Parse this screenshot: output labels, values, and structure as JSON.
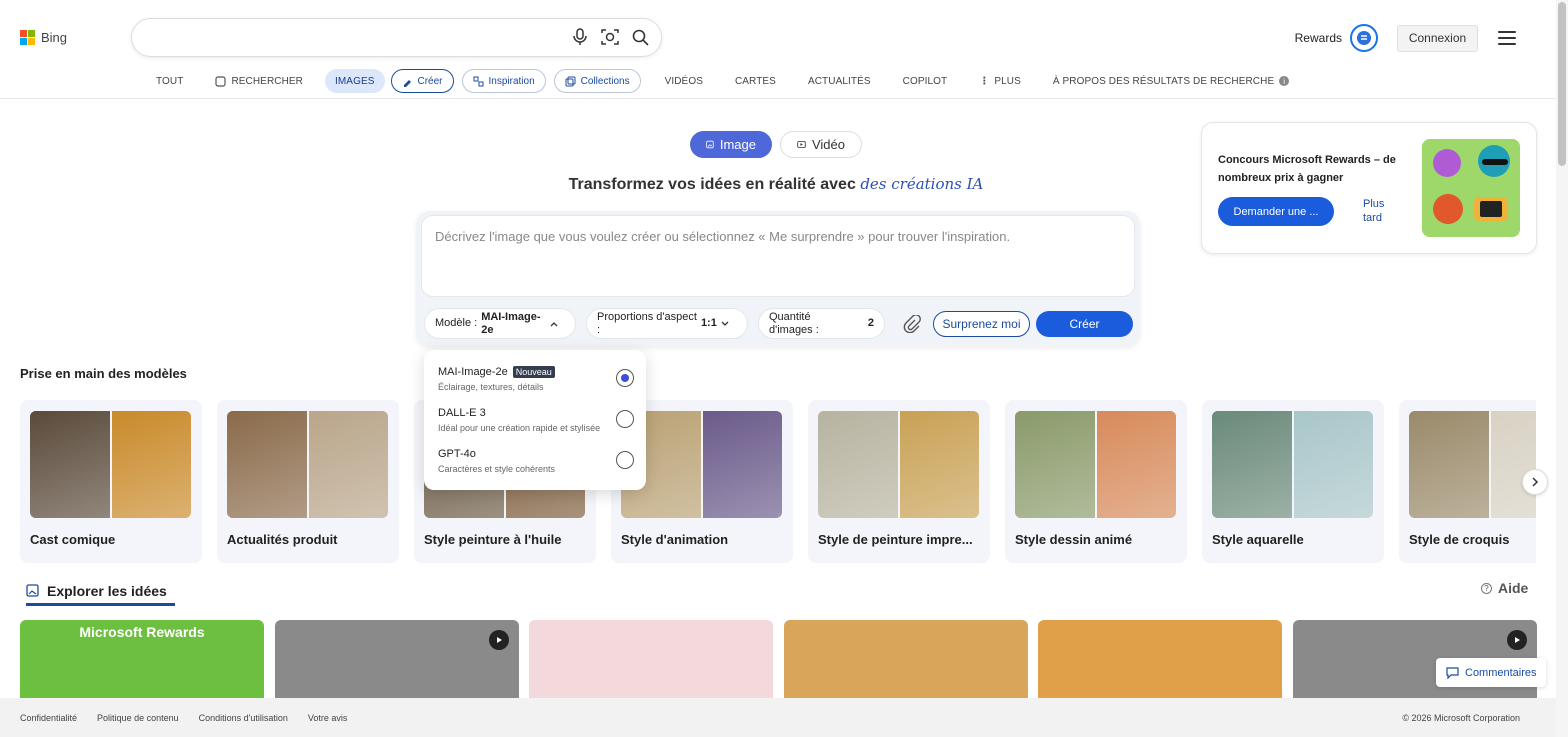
{
  "header": {
    "logo_text": "Bing",
    "rewards_label": "Rewards",
    "signin_label": "Connexion"
  },
  "nav": {
    "tout": "TOUT",
    "rechercher": "RECHERCHER",
    "images": "IMAGES",
    "creer": "Créer",
    "inspiration": "Inspiration",
    "collections": "Collections",
    "videos": "VIDÉOS",
    "cartes": "CARTES",
    "actualites": "ACTUALITÉS",
    "copilot": "COPILOT",
    "plus": "PLUS",
    "about": "À PROPOS DES RÉSULTATS DE RECHERCHE"
  },
  "toggle": {
    "image": "Image",
    "video": "Vidéo"
  },
  "headline": {
    "main": "Transformez vos idées en réalité avec",
    "accent": "des créations IA"
  },
  "prompt": {
    "placeholder": "Décrivez l'image que vous voulez créer ou sélectionnez « Me surprendre » pour trouver l'inspiration."
  },
  "controls": {
    "model_label": "Modèle :",
    "model_value_1": "MAI-Image-",
    "model_value_2": "2e",
    "aspect_label_1": "Proportions d'aspect",
    "aspect_label_2": ":",
    "aspect_value": "1:1",
    "quantity_label_1": "Quantité",
    "quantity_label_2": "d'images :",
    "quantity_value": "2",
    "surprise_label": "Surprenez moi",
    "create_label": "Créer"
  },
  "model_dropdown": {
    "options": [
      {
        "name": "MAI-Image-2e",
        "badge": "Nouveau",
        "desc": "Éclairage, textures, détails",
        "selected": true
      },
      {
        "name": "DALL-E 3",
        "badge": "",
        "desc": "Idéal pour une création rapide et stylisée",
        "selected": false
      },
      {
        "name": "GPT-4o",
        "badge": "",
        "desc": "Caractères et style cohérents",
        "selected": false
      }
    ]
  },
  "promo": {
    "title": "Concours Microsoft Rewards – de nombreux prix à gagner",
    "button": "Demander une ...",
    "later_1": "Plus",
    "later_2": "tard"
  },
  "models_section": {
    "title": "Prise en main des modèles",
    "cards": [
      {
        "title": "Cast comique",
        "colors": [
          "#5a4a3a",
          "#c98a2a"
        ]
      },
      {
        "title": "Actualités produit",
        "colors": [
          "#8a6a4a",
          "#b9a58a"
        ]
      },
      {
        "title": "Style peinture à l'huile",
        "colors": [
          "#6b5a44",
          "#7d5c3b"
        ]
      },
      {
        "title": "Style d'animation",
        "colors": [
          "#b9a173",
          "#6a5a8a"
        ]
      },
      {
        "title": "Style de peinture impre...",
        "colors": [
          "#b7b3a0",
          "#c9a155"
        ]
      },
      {
        "title": "Style dessin animé",
        "colors": [
          "#8a9a6a",
          "#d78a5a"
        ]
      },
      {
        "title": "Style aquarelle",
        "colors": [
          "#6a8a7a",
          "#a9c6c9"
        ]
      },
      {
        "title": "Style de croquis",
        "colors": [
          "#9a8a6a",
          "#d8d2c4"
        ]
      }
    ]
  },
  "explore": {
    "tab_label": "Explorer les idées",
    "help_label": "Aide",
    "tiles": [
      {
        "label": "Microsoft Rewards",
        "color": "#6cbf3f",
        "video": false
      },
      {
        "label": "",
        "color": "#8a8a8a",
        "video": true
      },
      {
        "label": "",
        "color": "#f3d9dc",
        "video": false
      },
      {
        "label": "",
        "color": "#d9a55a",
        "video": false
      },
      {
        "label": "",
        "color": "#e0a04a",
        "video": false
      },
      {
        "label": "",
        "color": "#8a8a8a",
        "video": true
      }
    ]
  },
  "feedback_label": "Commentaires",
  "footer": {
    "links": [
      "Confidentialité",
      "Politique de contenu",
      "Conditions d'utilisation",
      "Votre avis"
    ],
    "copyright": "© 2026 Microsoft Corporation"
  },
  "colors": {
    "accent": "#1a5cdb",
    "toggle_active": "#4e68d9",
    "nav_active_bg": "#dde7fb"
  }
}
